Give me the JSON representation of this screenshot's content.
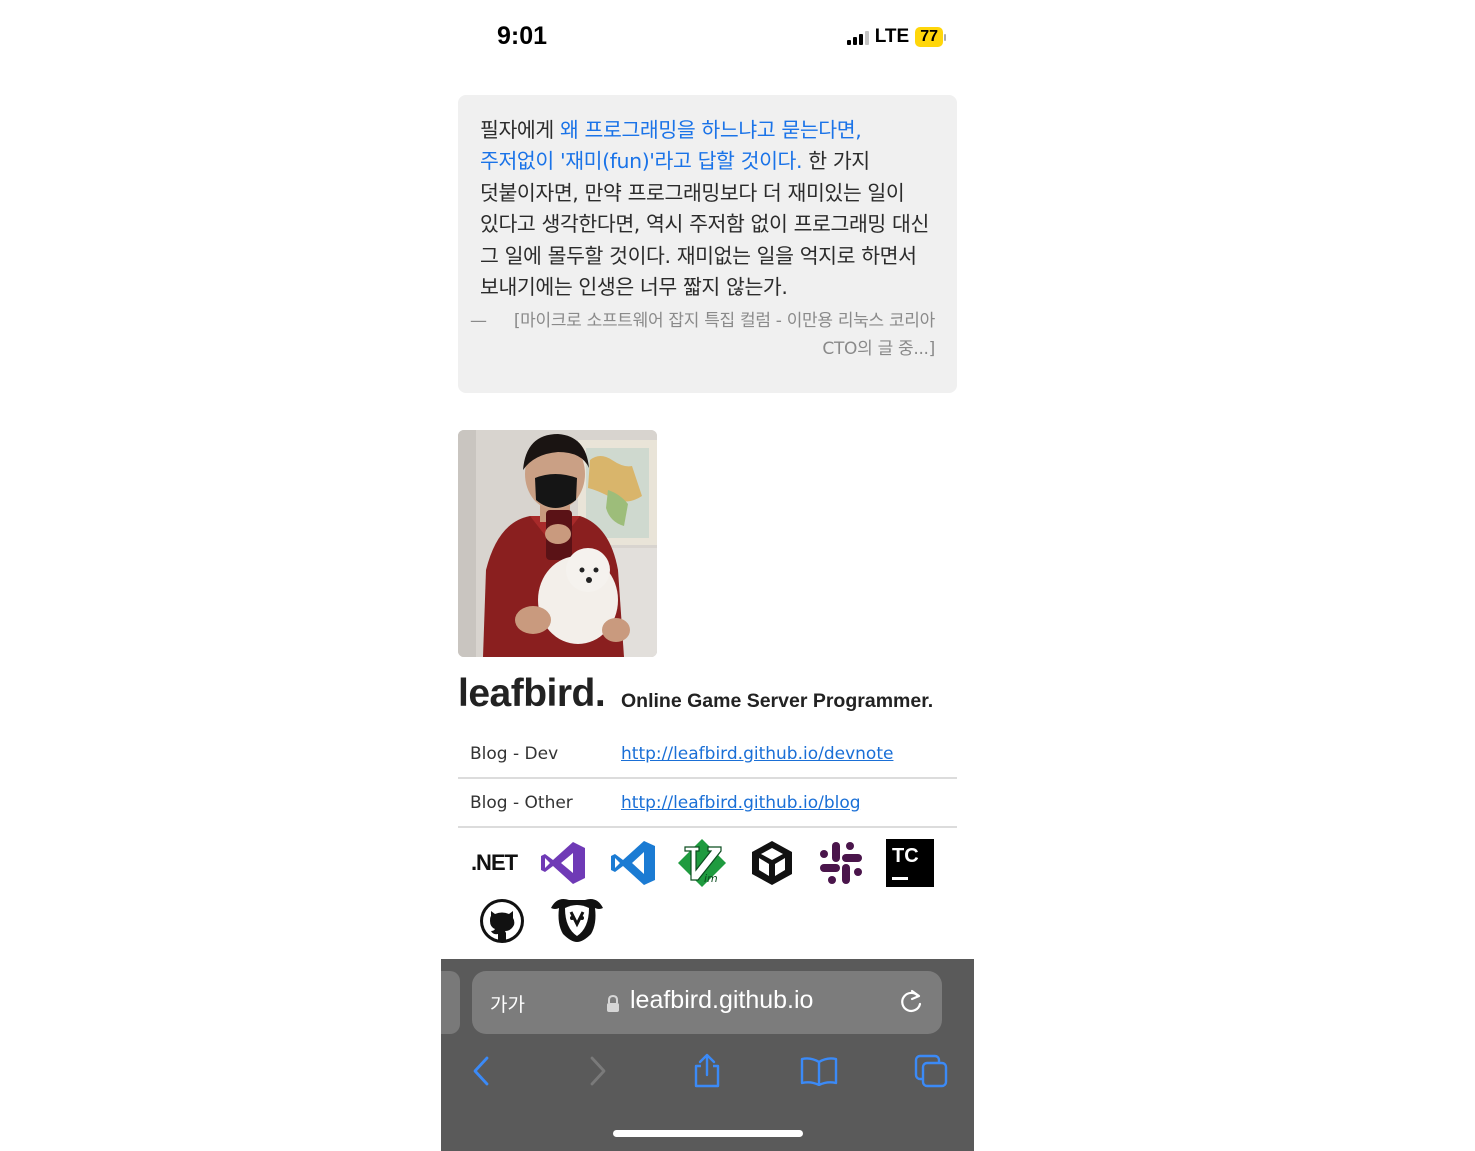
{
  "status_bar": {
    "time": "9:01",
    "network": "LTE",
    "battery": "77",
    "signal_bars": 3
  },
  "quote": {
    "prefix": "필자에게 ",
    "highlight": "왜 프로그래밍을 하느냐고 묻는다면, 주저없이 '재미(fun)'라고 답할 것이다.",
    "body": " 한 가지 덧붙이자면, 만약 프로그래밍보다 더 재미있는 일이 있다고 생각한다면, 역시 주저함 없이 프로그래밍 대신 그 일에 몰두할 것이다. 재미없는 일을 억지로 하면서 보내기에는 인생은 너무 짧지 않는가.",
    "dash": "—",
    "source": "[마이크로 소프트웨어 잡지 특집 컬럼 - 이만용 리눅스 코리아 CTO의 글 중...]"
  },
  "profile": {
    "name": "leafbird.",
    "role": "Online Game Server Programmer."
  },
  "links": [
    {
      "label": "Blog - Dev",
      "url": "http://leafbird.github.io/devnote"
    },
    {
      "label": "Blog - Other",
      "url": "http://leafbird.github.io/blog"
    }
  ],
  "tech_icons": {
    "net_label": ".NET",
    "items": [
      "dotnet-icon",
      "visual-studio-icon",
      "vscode-icon",
      "vim-icon",
      "unity-icon",
      "slack-icon",
      "teamcity-icon",
      "github-icon",
      "bitbucket-mascot-icon"
    ],
    "teamcity_label": "TC"
  },
  "browser": {
    "text_size_label": "가가",
    "host": "leafbird.github.io",
    "accent": "#2f7cf6"
  }
}
